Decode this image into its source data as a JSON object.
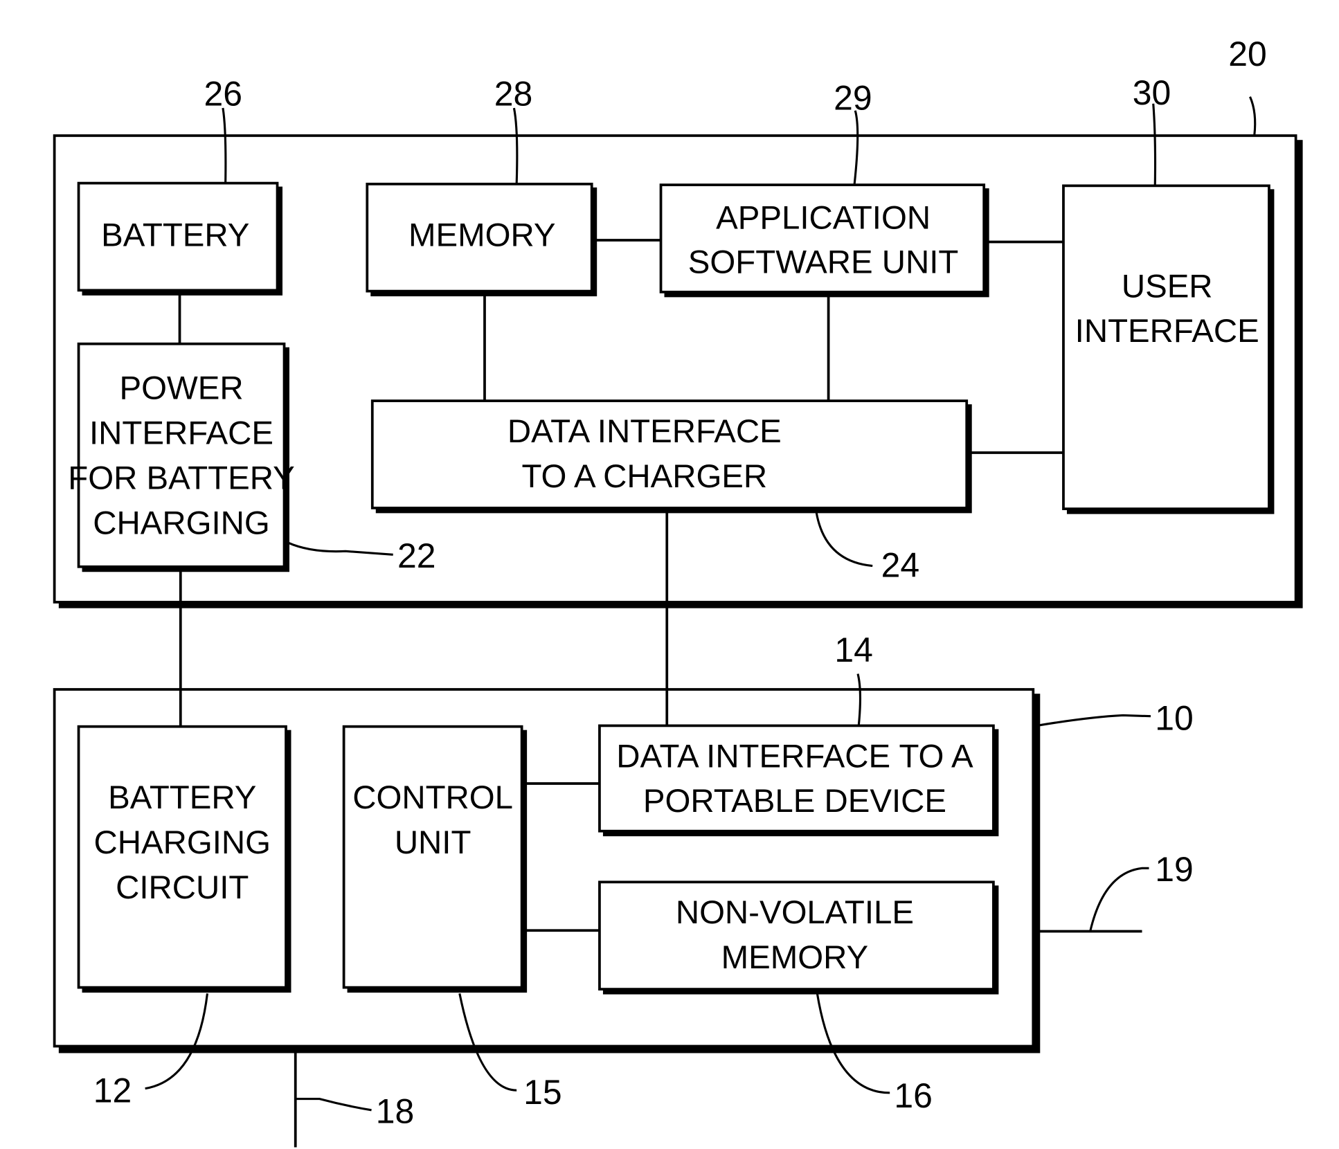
{
  "diagram": {
    "type": "block-diagram",
    "colors": {
      "line": "#000000",
      "background": "#ffffff"
    },
    "portable_device": {
      "ref": "20",
      "blocks": {
        "battery": {
          "ref": "26",
          "lines": [
            "BATTERY"
          ]
        },
        "memory": {
          "ref": "28",
          "lines": [
            "MEMORY"
          ]
        },
        "app_software": {
          "ref": "29",
          "lines": [
            "APPLICATION",
            "SOFTWARE UNIT"
          ]
        },
        "user_interface": {
          "ref": "30",
          "lines": [
            "USER",
            "INTERFACE"
          ]
        },
        "power_interface": {
          "ref": "22",
          "lines": [
            "POWER",
            "INTERFACE",
            "FOR BATTERY",
            "CHARGING"
          ]
        },
        "data_interface_charger": {
          "ref": "24",
          "lines": [
            "DATA INTERFACE",
            "TO A CHARGER"
          ]
        }
      }
    },
    "charger": {
      "ref": "10",
      "blocks": {
        "battery_charging_circuit": {
          "ref": "12",
          "lines": [
            "BATTERY",
            "CHARGING",
            "CIRCUIT"
          ]
        },
        "control_unit": {
          "ref": "15",
          "lines": [
            "CONTROL",
            "UNIT"
          ]
        },
        "data_interface_portable": {
          "ref": "14",
          "lines": [
            "DATA INTERFACE TO A",
            "PORTABLE DEVICE"
          ]
        },
        "non_volatile_memory": {
          "ref": "16",
          "lines": [
            "NON-VOLATILE",
            "MEMORY"
          ]
        }
      },
      "external": {
        "power_line_ref": "18",
        "data_line_ref": "19"
      }
    },
    "connections": [
      [
        "battery",
        "power_interface"
      ],
      [
        "memory",
        "app_software"
      ],
      [
        "app_software",
        "user_interface"
      ],
      [
        "memory",
        "data_interface_charger"
      ],
      [
        "app_software",
        "data_interface_charger"
      ],
      [
        "data_interface_charger",
        "user_interface"
      ],
      [
        "power_interface",
        "battery_charging_circuit"
      ],
      [
        "data_interface_charger",
        "data_interface_portable"
      ],
      [
        "control_unit",
        "data_interface_portable"
      ],
      [
        "control_unit",
        "non_volatile_memory"
      ]
    ]
  }
}
